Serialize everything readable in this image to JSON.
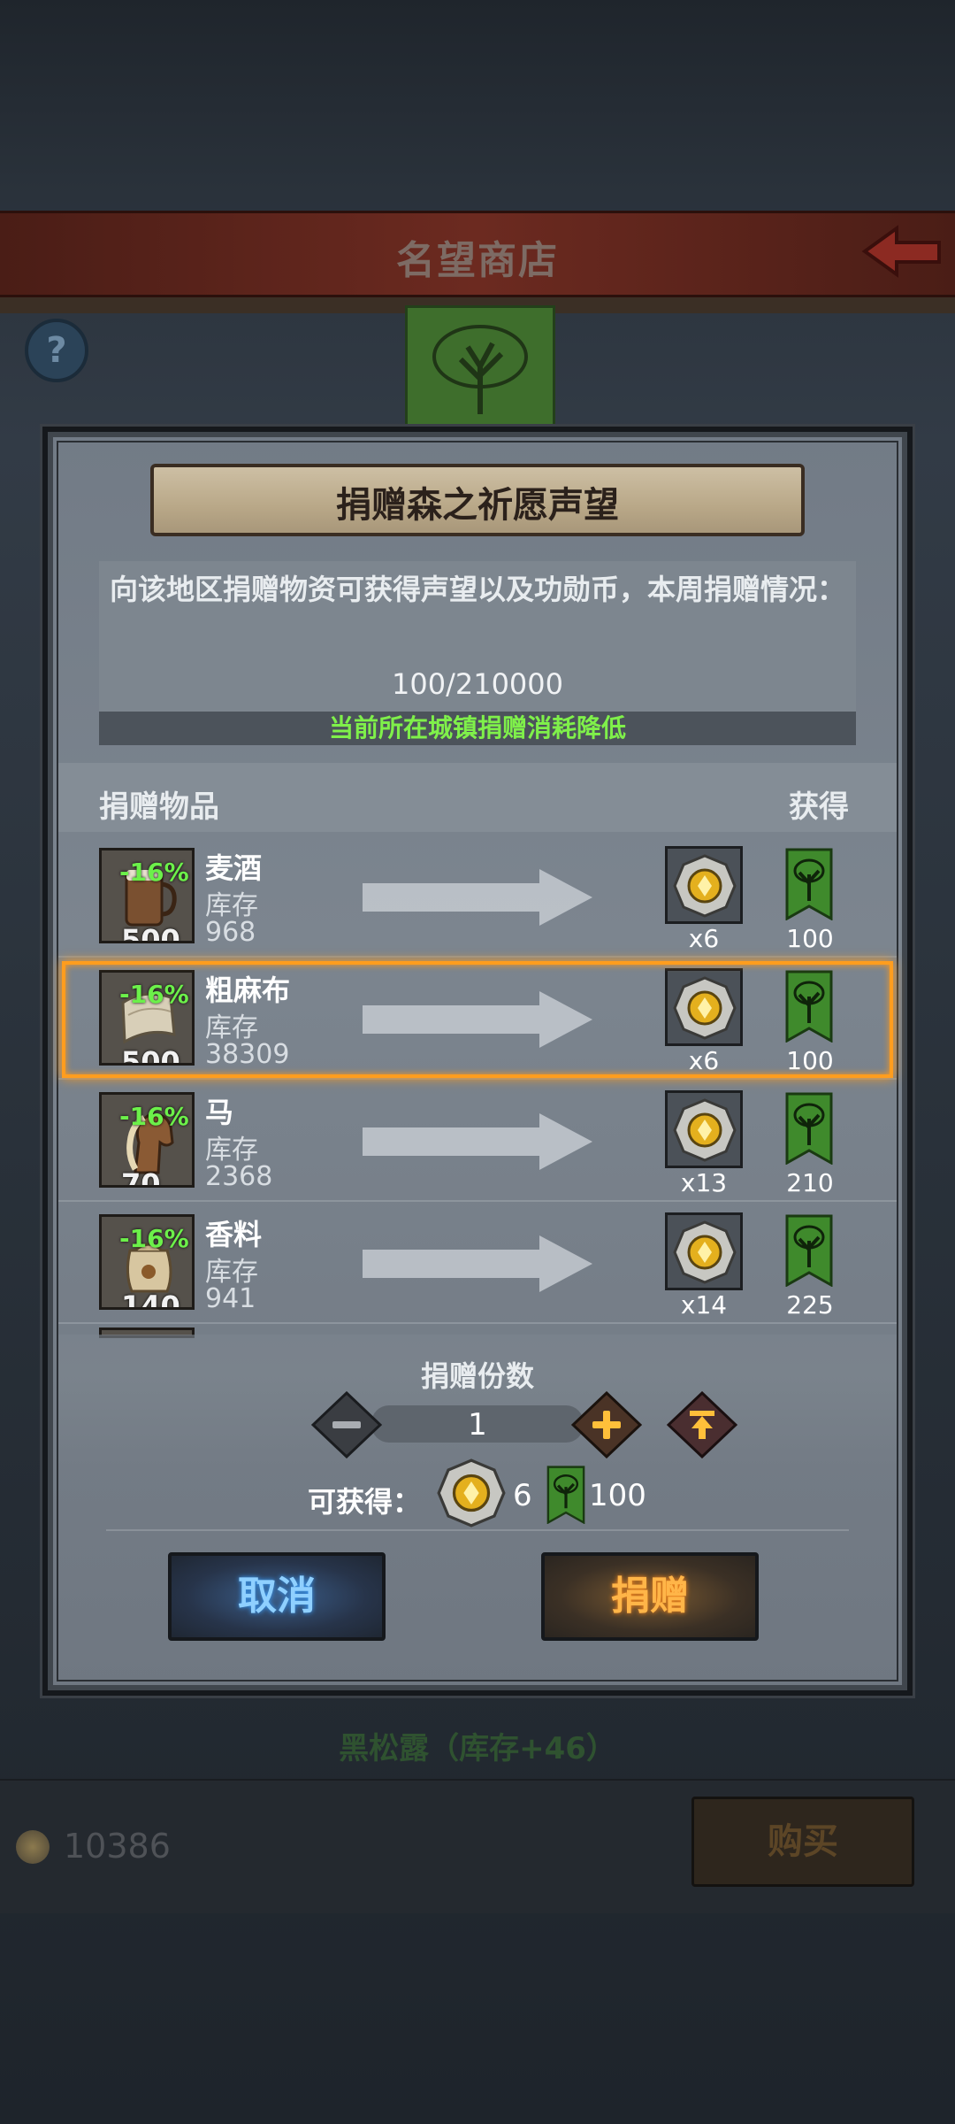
{
  "shop": {
    "title": "名望商店"
  },
  "background": {
    "item_name": "黑松露（库存+46）",
    "coin_count": "10386",
    "buy_label": "购买"
  },
  "modal": {
    "title": "捐赠森之祈愿声望",
    "info": "向该地区捐赠物资可获得声望以及功勋币，本周捐赠情况：",
    "progress": "100/210000",
    "discount_notice": "当前所在城镇捐赠消耗降低",
    "col_item": "捐赠物品",
    "col_gain": "获得",
    "stock_label": "库存",
    "items": [
      {
        "name": "麦酒",
        "discount": "-16%",
        "qty": "500",
        "stock": "968",
        "coin": "x6",
        "fame": "100",
        "icon": "ale-mug-icon"
      },
      {
        "name": "粗麻布",
        "discount": "-16%",
        "qty": "500",
        "stock": "38309",
        "coin": "x6",
        "fame": "100",
        "icon": "linen-cloth-icon"
      },
      {
        "name": "马",
        "discount": "-16%",
        "qty": "70",
        "stock": "2368",
        "coin": "x13",
        "fame": "210",
        "icon": "horse-icon"
      },
      {
        "name": "香料",
        "discount": "-16%",
        "qty": "140",
        "stock": "941",
        "coin": "x14",
        "fame": "225",
        "icon": "spice-sack-icon"
      }
    ],
    "count_label": "捐赠份数",
    "count_value": "1",
    "can_get_label": "可获得：",
    "can_get_coin": "6",
    "can_get_fame": "100",
    "cancel_label": "取消",
    "donate_label": "捐赠"
  },
  "colors": {
    "discount_green": "#6cf04a",
    "highlight_orange": "#ff9d1e",
    "cancel_blue": "#8fd0ff",
    "donate_orange": "#ffb548",
    "banner_green": "#3f8a2c"
  }
}
